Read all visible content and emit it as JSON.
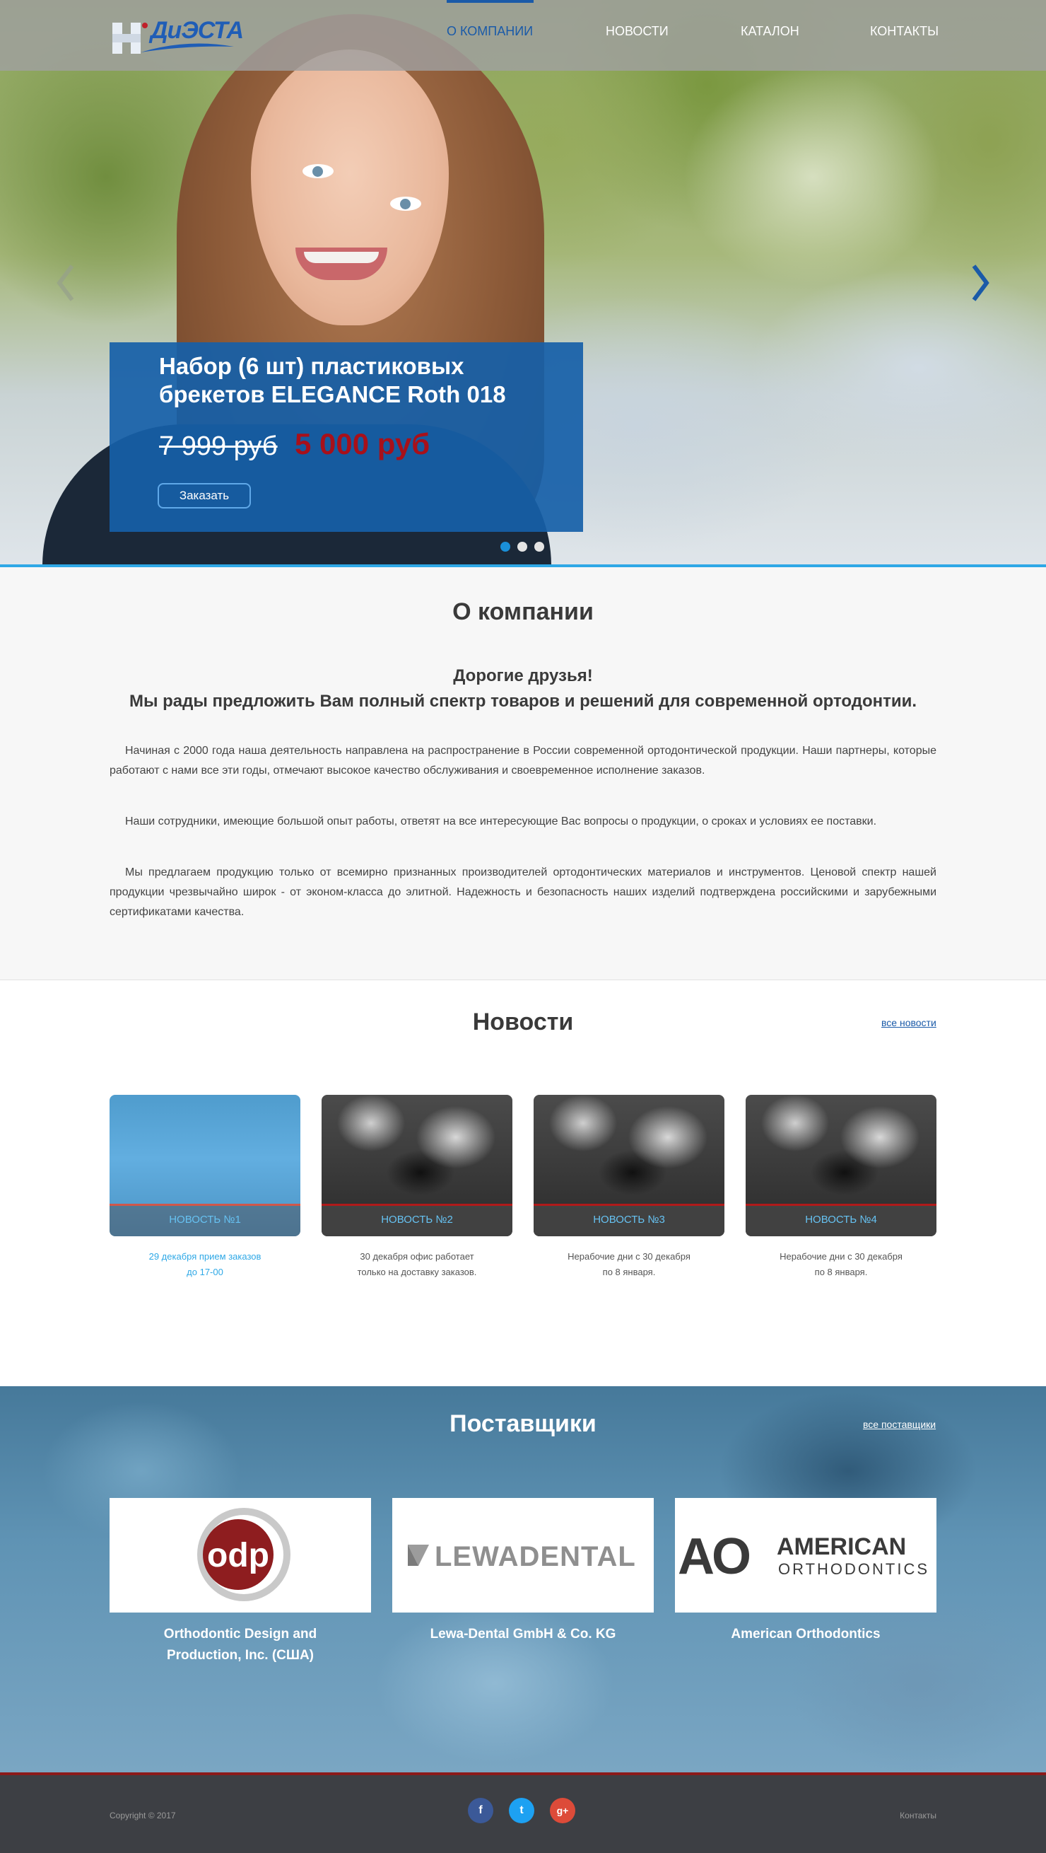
{
  "header": {
    "logo_text": "ДиЭСТА",
    "nav": [
      {
        "label": "О компании",
        "active": true
      },
      {
        "label": "Новости",
        "active": false
      },
      {
        "label": "Каталон",
        "active": false
      },
      {
        "label": "Контакты",
        "active": false
      }
    ]
  },
  "slider": {
    "title": "Набор (6 шт) пластиковых брекетов ELEGANCE Roth 018",
    "old_price": "7 999 руб",
    "new_price": "5 000 руб",
    "order_label": "Заказать",
    "dots": [
      true,
      false,
      false
    ]
  },
  "about": {
    "title": "О компании",
    "greeting_1": "Дорогие друзья!",
    "greeting_2": "Мы рады предложить Вам полный спектр товаров и решений для современной ортодонтии.",
    "p1": "Начиная с 2000 года наша деятельность направлена на распространение в России современной ортодонтической продукции. Наши партнеры, которые работают с нами все эти годы,  отмечают высокое качество обслуживания и своевременное исполнение заказов.",
    "p2": "Наши сотрудники, имеющие большой опыт работы, ответят на все интересующие Вас вопросы о продукции, о сроках и условиях ее поставки.",
    "p3": "Мы предлагаем продукцию только от всемирно признанных производителей ортодонтических материалов и инструментов. Ценовой спектр нашей продукции чрезвычайно широк - от эконом-класса до элитной. Надежность и безопасность наших изделий подтверждена российскими и зарубежными сертификатами качества."
  },
  "news": {
    "title": "Новости",
    "all_link": "все новости",
    "items": [
      {
        "label": "НОВОСТЬ №1",
        "text_1": "29 декабря прием заказов",
        "text_2": "до 17-00"
      },
      {
        "label": "НОВОСТЬ №2",
        "text_1": "30 декабря офис работает",
        "text_2": "только на доставку заказов."
      },
      {
        "label": "НОВОСТЬ №3",
        "text_1": "Нерабочие дни с 30 декабря",
        "text_2": "по 8 января."
      },
      {
        "label": "НОВОСТЬ №4",
        "text_1": "Нерабочие дни с 30 декабря",
        "text_2": "по 8 января."
      }
    ]
  },
  "suppliers": {
    "title": "Поставщики",
    "all_link": "все поставщики",
    "items": [
      {
        "logo": "odp",
        "name_1": "Orthodontic Design and",
        "name_2": "Production, Inc. (США)"
      },
      {
        "logo": "LEWADENTAL",
        "name_1": "Lewa-Dental GmbH & Co. KG",
        "name_2": ""
      },
      {
        "logo_mark": "AO",
        "logo_text_1": "AMERICAN",
        "logo_text_2": "ORTHODONTICS",
        "name_1": "American Orthodontics",
        "name_2": ""
      }
    ]
  },
  "footer": {
    "copyright": "Copyright © 2017",
    "contacts_link": "Контакты",
    "social": [
      {
        "icon": "facebook-icon",
        "glyph": "f",
        "color": "#3b5998"
      },
      {
        "icon": "twitter-icon",
        "glyph": "t",
        "color": "#1da1f2"
      },
      {
        "icon": "google-plus-icon",
        "glyph": "g+",
        "color": "#dd4b39"
      }
    ]
  },
  "colors": {
    "accent": "#1a5aa8",
    "sky": "#2ea8e6",
    "price_red": "#a8101a",
    "footer_bg": "#3d3f44"
  }
}
